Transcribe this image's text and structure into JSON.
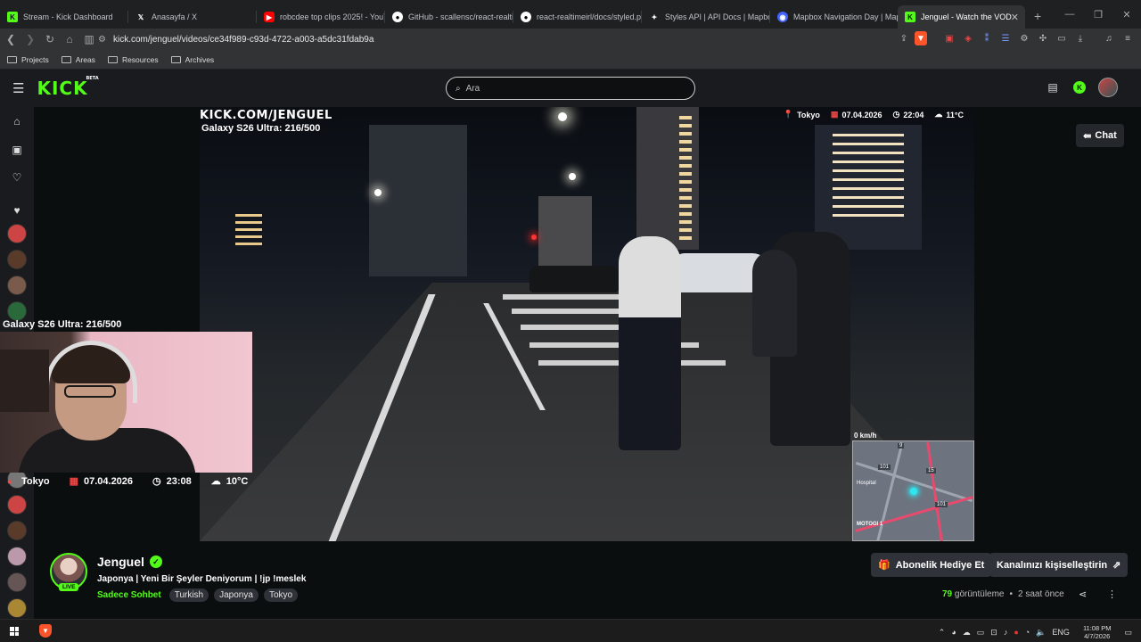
{
  "browser": {
    "tabs": [
      {
        "title": "Stream - Kick Dashboard",
        "icon": "kick-icon",
        "color": "#53fc18"
      },
      {
        "title": "Anasayfa / X",
        "icon": "x-icon",
        "color": "#ffffff"
      },
      {
        "title": "robcdee top clips 2025! - YouT",
        "icon": "youtube-icon",
        "color": "#ff0000"
      },
      {
        "title": "GitHub - scallensc/react-realtir",
        "icon": "github-icon",
        "color": "#ffffff"
      },
      {
        "title": "react-realtimeirl/docs/styled.p",
        "icon": "github-icon",
        "color": "#ffffff"
      },
      {
        "title": "Styles API | API Docs | Mapbox",
        "icon": "mapbox-icon",
        "color": "#ffffff"
      },
      {
        "title": "Mapbox Navigation Day | Map",
        "icon": "mapbox-icon",
        "color": "#4264fb"
      },
      {
        "title": "Jenguel - Watch the VOD",
        "icon": "kick-icon",
        "color": "#53fc18"
      }
    ],
    "url": "kick.com/jenguel/videos/ce34f989-c93d-4722-a003-a5dc31fdab9a",
    "bookmarks": [
      "Projects",
      "Areas",
      "Resources",
      "Archives"
    ]
  },
  "header": {
    "logo": "KICK",
    "logo_beta": "BETA",
    "search_placeholder": "Ara"
  },
  "video": {
    "overlay_logo": "KICK.COM/JENGUEL",
    "overlay_sub": "Galaxy S26 Ultra: 216/500",
    "location": "Tokyo",
    "date": "07.04.2026",
    "time": "22:04",
    "temp": "11°C",
    "speed": "0 km/h",
    "map_labels": [
      "9",
      "101",
      "15",
      "101",
      "MOTOGI 1",
      "Hospital"
    ]
  },
  "cam": {
    "caption": "Galaxy S26 Ultra: 216/500",
    "location": "Tokyo",
    "date": "07.04.2026",
    "time": "23:08",
    "temp": "10°C"
  },
  "chat_button": "Chat",
  "channel": {
    "name": "Jenguel",
    "live_badge": "LIVE",
    "title": "Japonya | Yeni Bir Şeyler Deniyorum | !jp !meslek",
    "category": "Sadece Sohbet",
    "tags": [
      "Turkish",
      "Japonya",
      "Tokyo"
    ],
    "gift_button": "Abonelik Hediye Et",
    "customize_button": "Kanalınızı kişiselleştirin",
    "views_count": "79",
    "views_label": "görüntüleme",
    "separator": "•",
    "ago": "2 saat önce"
  },
  "taskbar": {
    "lang": "ENG",
    "time": "11:08 PM",
    "date": "4/7/2026"
  },
  "colors": {
    "kick_green": "#53fc18",
    "bg": "#0b0e0f",
    "panel": "#191b1f"
  }
}
